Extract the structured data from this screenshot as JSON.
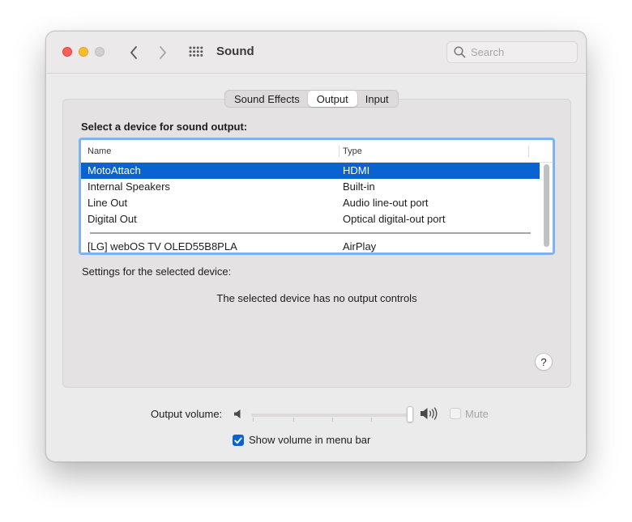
{
  "window": {
    "title": "Sound"
  },
  "search": {
    "placeholder": "Search"
  },
  "tabs": [
    {
      "label": "Sound Effects",
      "active": false
    },
    {
      "label": "Output",
      "active": true
    },
    {
      "label": "Input",
      "active": false
    }
  ],
  "output": {
    "section_title": "Select a device for sound output:",
    "columns": {
      "name": "Name",
      "type": "Type"
    },
    "devices": [
      {
        "name": "MotoAttach",
        "type": "HDMI",
        "selected": true
      },
      {
        "name": "Internal Speakers",
        "type": "Built-in",
        "selected": false
      },
      {
        "name": "Line Out",
        "type": "Audio line-out port",
        "selected": false
      },
      {
        "name": "Digital Out",
        "type": "Optical digital-out port",
        "selected": false
      },
      {
        "name": "[LG] webOS TV OLED55B8PLA",
        "type": "AirPlay",
        "selected": false
      }
    ],
    "settings_label": "Settings for the selected device:",
    "no_controls_message": "The selected device has no output controls",
    "help_label": "?"
  },
  "volume": {
    "label": "Output volume:",
    "level": 1.0,
    "mute_label": "Mute",
    "mute_checked": false,
    "mute_enabled": false
  },
  "menubar": {
    "show_label": "Show volume in menu bar",
    "show_checked": true
  },
  "colors": {
    "accent": "#0a63d1",
    "focus_ring": "#7fb2f2",
    "close": "#ff5f57",
    "minimize": "#febc2e",
    "zoom_inactive": "#d0d0d0"
  }
}
